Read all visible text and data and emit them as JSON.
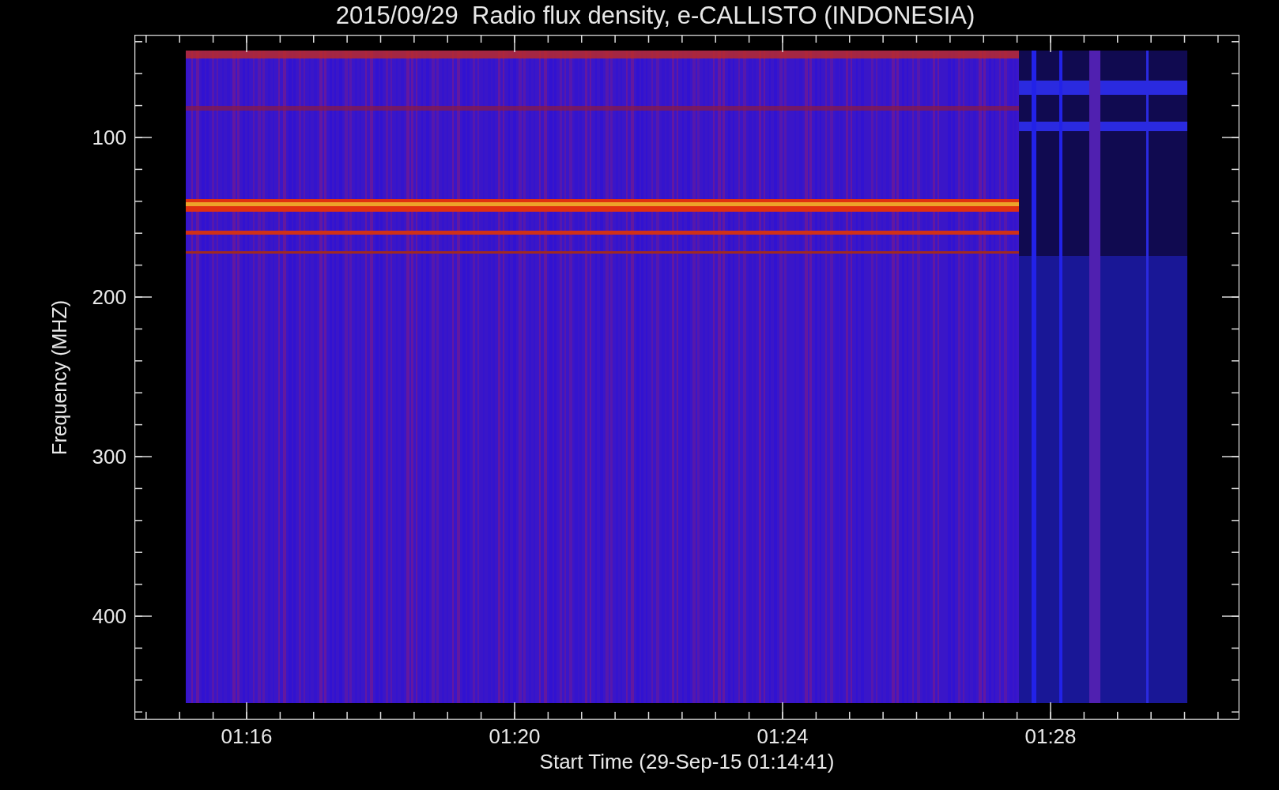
{
  "title": "2015/09/29  Radio flux density, e-CALLISTO (INDONESIA)",
  "y_axis": {
    "label": "Frequency (MHZ)",
    "ticks": [
      "100",
      "200",
      "300",
      "400"
    ]
  },
  "x_axis": {
    "label": "Start Time (29-Sep-15 01:14:41)",
    "ticks": [
      "01:16",
      "01:20",
      "01:24",
      "01:28"
    ]
  }
}
